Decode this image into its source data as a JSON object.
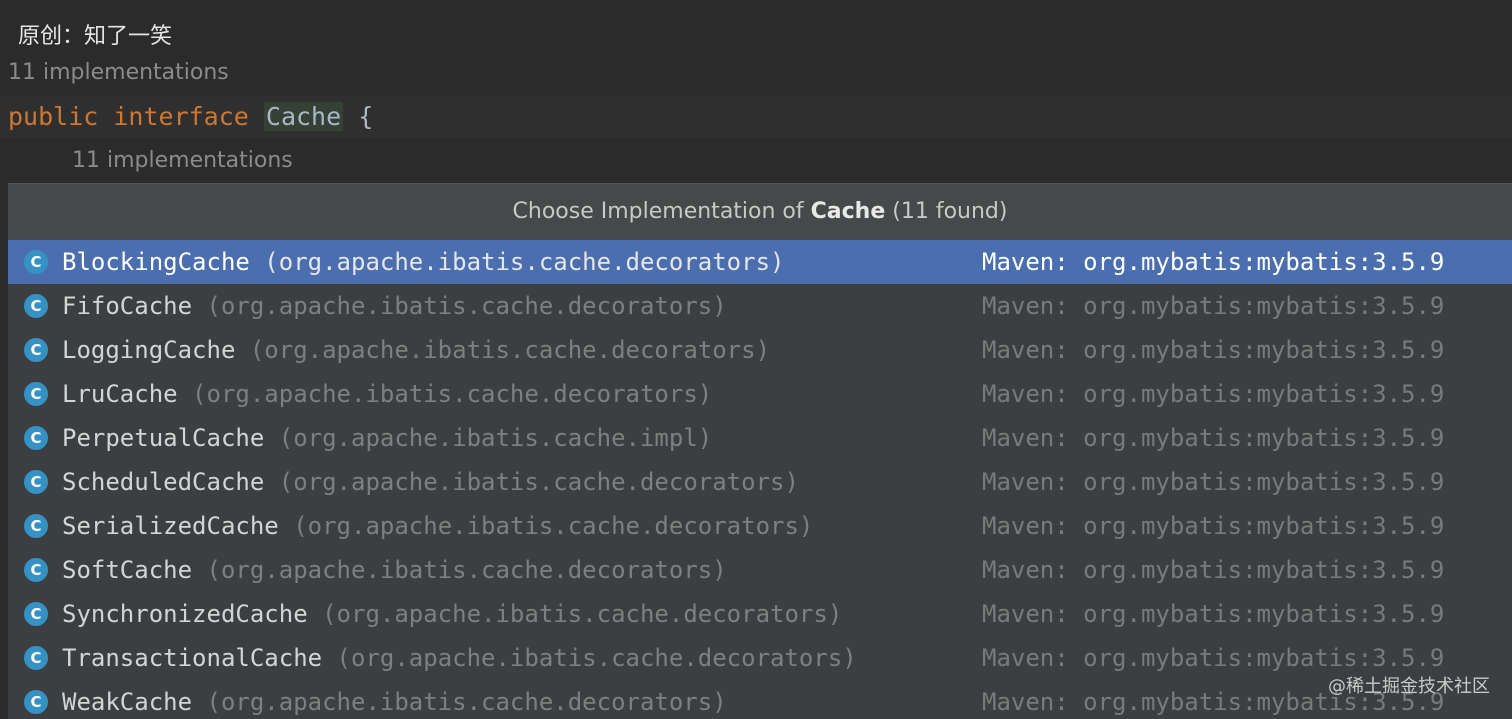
{
  "caption": "原创：知了一笑",
  "editor": {
    "hint_top": "11 implementations",
    "code": {
      "kw_public": "public",
      "kw_interface": "interface",
      "class_name": "Cache",
      "brace": "{"
    },
    "hint_inner": "11 implementations"
  },
  "popup": {
    "title_prefix": "Choose Implementation of ",
    "title_class": "Cache",
    "title_suffix": " (11 found)",
    "items": [
      {
        "icon": "C",
        "name": "BlockingCache",
        "package": " (org.apache.ibatis.cache.decorators)",
        "library": "Maven: org.mybatis:mybatis:3.5.9"
      },
      {
        "icon": "C",
        "name": "FifoCache",
        "package": " (org.apache.ibatis.cache.decorators)",
        "library": "Maven: org.mybatis:mybatis:3.5.9"
      },
      {
        "icon": "C",
        "name": "LoggingCache",
        "package": " (org.apache.ibatis.cache.decorators)",
        "library": "Maven: org.mybatis:mybatis:3.5.9"
      },
      {
        "icon": "C",
        "name": "LruCache",
        "package": " (org.apache.ibatis.cache.decorators)",
        "library": "Maven: org.mybatis:mybatis:3.5.9"
      },
      {
        "icon": "C",
        "name": "PerpetualCache",
        "package": " (org.apache.ibatis.cache.impl)",
        "library": "Maven: org.mybatis:mybatis:3.5.9"
      },
      {
        "icon": "C",
        "name": "ScheduledCache",
        "package": " (org.apache.ibatis.cache.decorators)",
        "library": "Maven: org.mybatis:mybatis:3.5.9"
      },
      {
        "icon": "C",
        "name": "SerializedCache",
        "package": " (org.apache.ibatis.cache.decorators)",
        "library": "Maven: org.mybatis:mybatis:3.5.9"
      },
      {
        "icon": "C",
        "name": "SoftCache",
        "package": " (org.apache.ibatis.cache.decorators)",
        "library": "Maven: org.mybatis:mybatis:3.5.9"
      },
      {
        "icon": "C",
        "name": "SynchronizedCache",
        "package": " (org.apache.ibatis.cache.decorators)",
        "library": "Maven: org.mybatis:mybatis:3.5.9"
      },
      {
        "icon": "C",
        "name": "TransactionalCache",
        "package": " (org.apache.ibatis.cache.decorators)",
        "library": "Maven: org.mybatis:mybatis:3.5.9"
      },
      {
        "icon": "C",
        "name": "WeakCache",
        "package": " (org.apache.ibatis.cache.decorators)",
        "library": "Maven: org.mybatis:mybatis:3.5.9"
      }
    ]
  },
  "watermark": "@稀土掘金技术社区",
  "colors": {
    "background": "#2b2b2b",
    "keyword": "#cc7832",
    "selection": "#4b6eaf",
    "class_icon": "#3592c4"
  }
}
